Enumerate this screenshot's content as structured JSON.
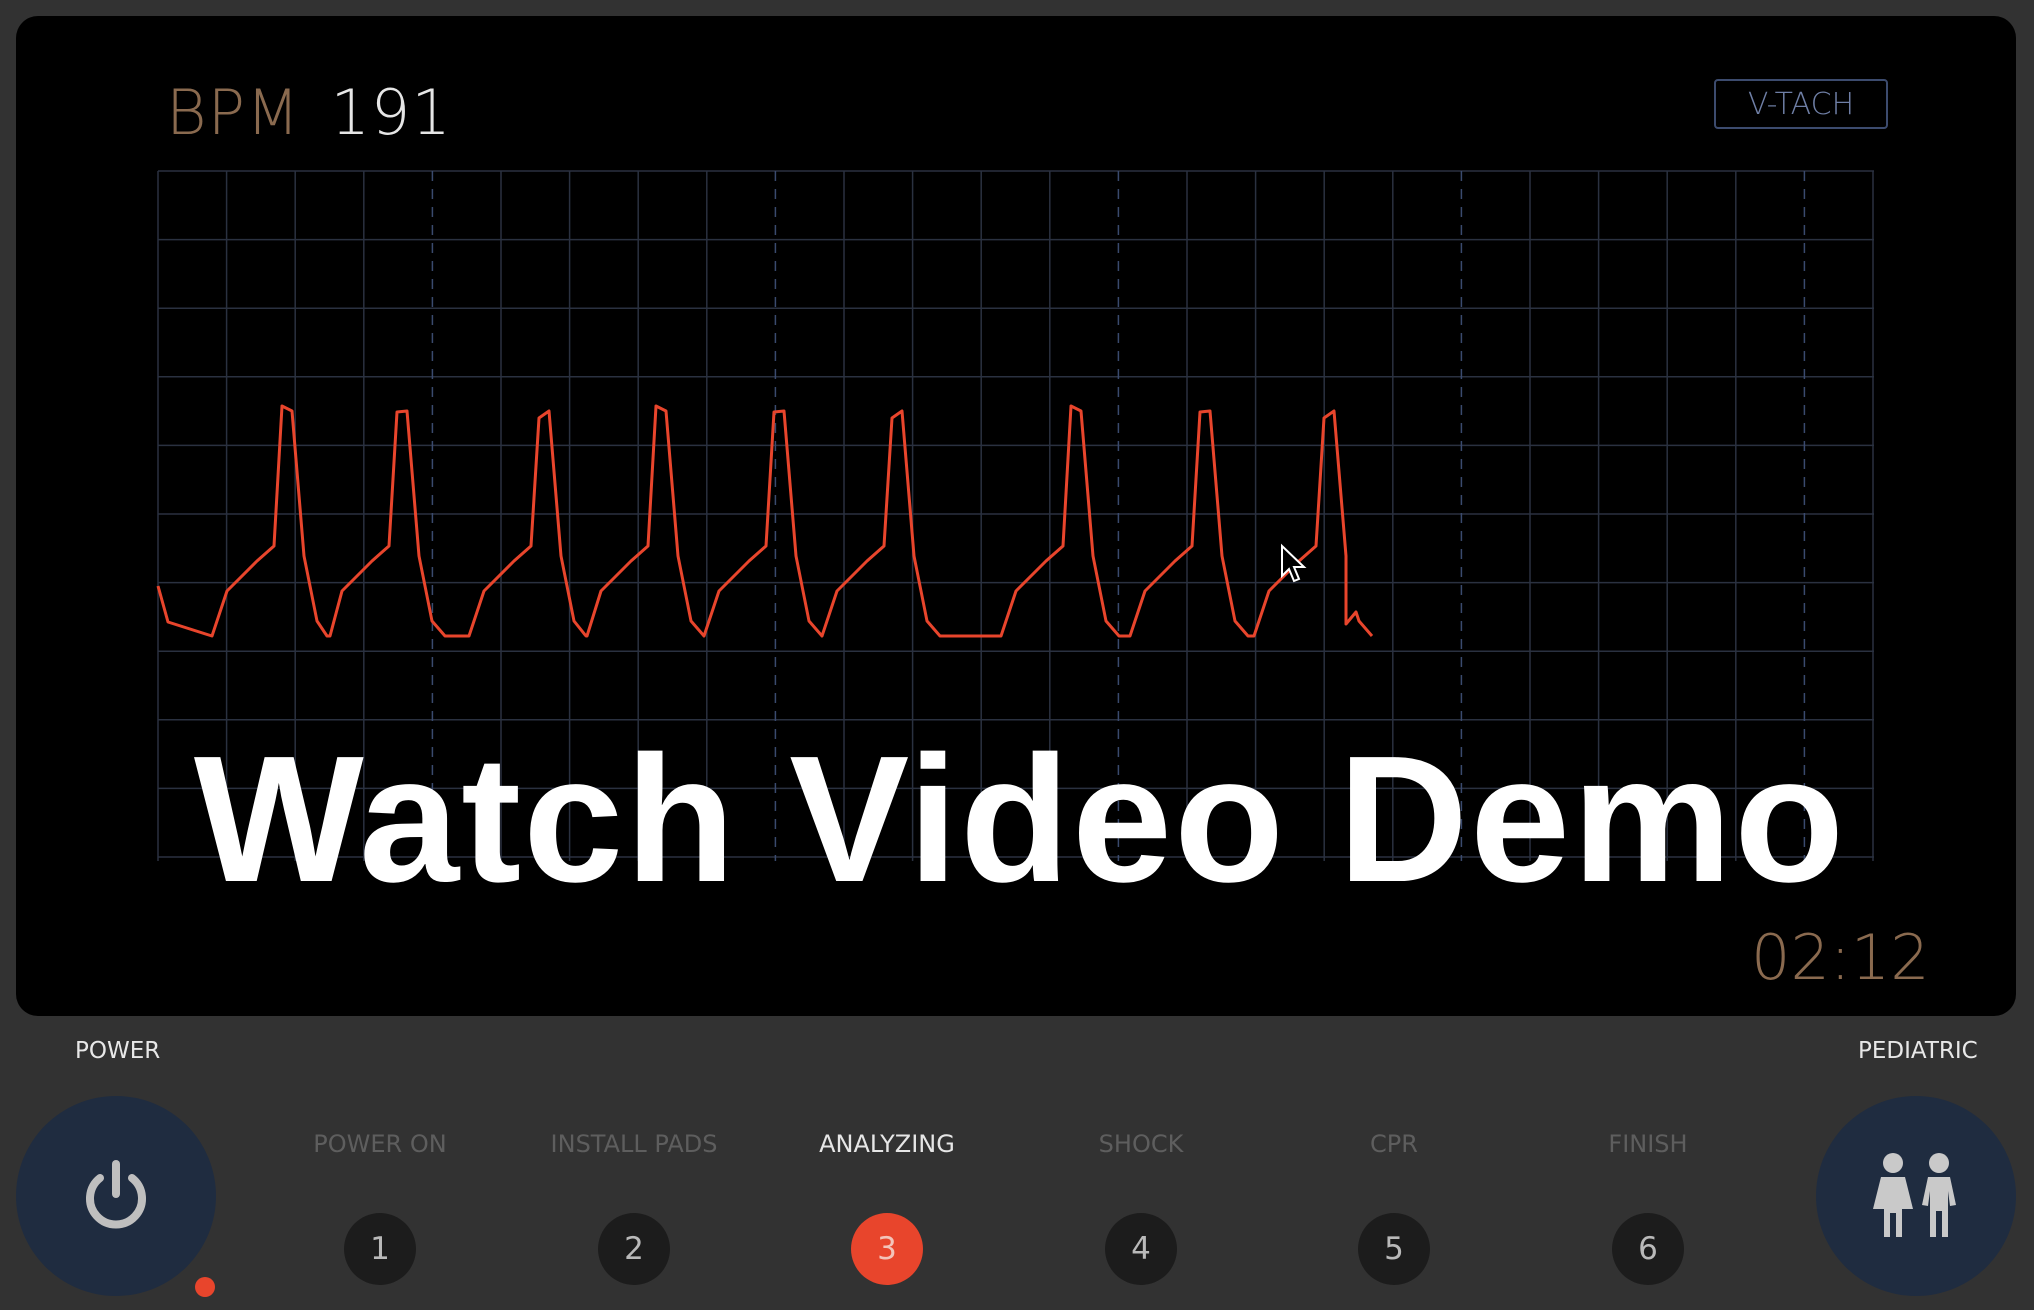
{
  "monitor": {
    "bpm_label": "BPM",
    "bpm_value": "191",
    "rhythm": "V-TACH",
    "overlay_title": "Watch Video Demo",
    "timer": "02:12",
    "trace_color": "#e8452c"
  },
  "controls": {
    "power_label": "POWER",
    "pediatric_label": "PEDIATRIC"
  },
  "steps": [
    {
      "label": "POWER ON",
      "number": "1"
    },
    {
      "label": "INSTALL PADS",
      "number": "2"
    },
    {
      "label": "ANALYZING",
      "number": "3",
      "active": true
    },
    {
      "label": "SHOCK",
      "number": "4"
    },
    {
      "label": "CPR",
      "number": "5"
    },
    {
      "label": "FINISH",
      "number": "6"
    }
  ],
  "colors": {
    "background": "#323232",
    "screen": "#000000",
    "accent": "#e8452c",
    "button": "#1f2c40"
  }
}
